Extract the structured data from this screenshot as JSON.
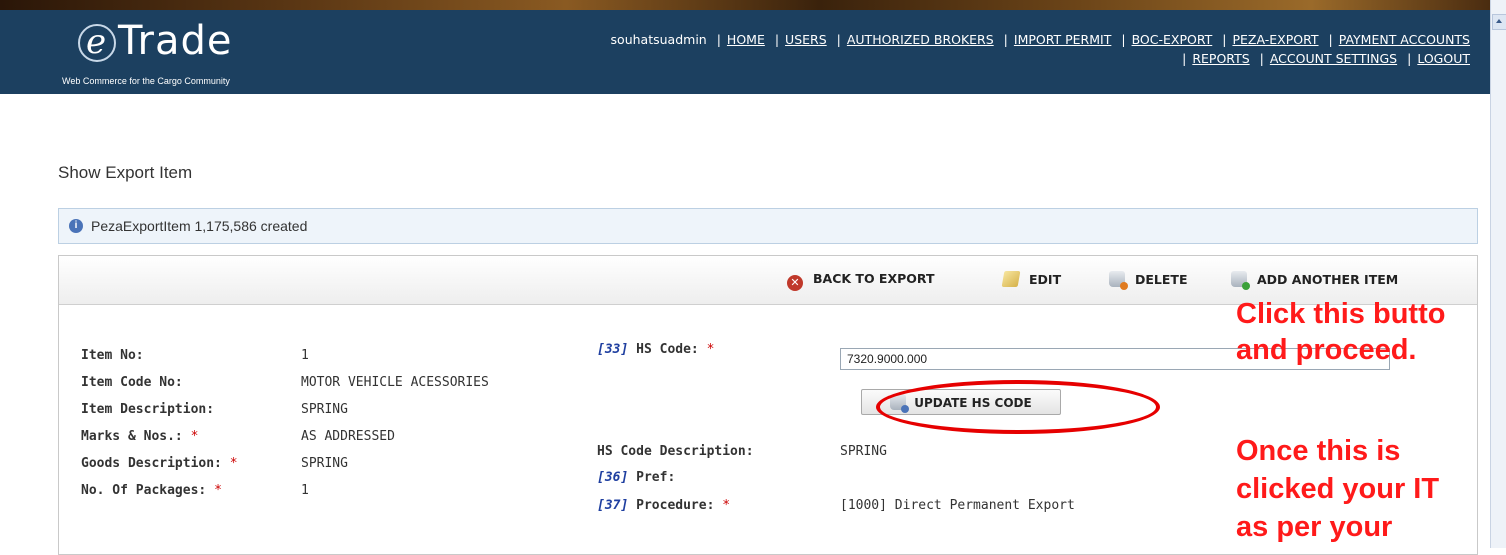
{
  "header": {
    "logo_letter": "e",
    "logo_word": "Trade",
    "tagline": "Web Commerce  for the Cargo Community",
    "username": "souhatsuadmin",
    "nav_row1": [
      "HOME",
      "USERS",
      "AUTHORIZED BROKERS",
      "IMPORT PERMIT",
      "BOC-EXPORT",
      "PEZA-EXPORT",
      "PAYMENT ACCOUNTS"
    ],
    "nav_row2": [
      "REPORTS",
      "ACCOUNT SETTINGS",
      "LOGOUT"
    ]
  },
  "page": {
    "title": "Show Export Item",
    "message": "PezaExportItem 1,175,586 created"
  },
  "toolbar": {
    "back_label": "BACK TO EXPORT",
    "edit_label": "EDIT",
    "delete_label": "DELETE",
    "add_label": "ADD ANOTHER ITEM"
  },
  "left_fields": [
    {
      "label": "Item No:",
      "required": false,
      "value": "1"
    },
    {
      "label": "Item Code No:",
      "required": false,
      "value": "MOTOR VEHICLE ACESSORIES"
    },
    {
      "label": "Item Description:",
      "required": false,
      "value": "SPRING"
    },
    {
      "label": "Marks & Nos.:",
      "required": true,
      "value": "AS ADDRESSED"
    },
    {
      "label": "Goods Description:",
      "required": true,
      "value": "SPRING"
    },
    {
      "label": "No. Of Packages:",
      "required": true,
      "value": "1"
    }
  ],
  "right_fields": {
    "hs_code_ref": "[33]",
    "hs_code_label": "HS Code:",
    "hs_code_value": "7320.9000.000",
    "update_button": "UPDATE HS CODE",
    "hs_desc_label": "HS Code Description:",
    "hs_desc_value": "SPRING",
    "pref_ref": "[36]",
    "pref_label": "Pref:",
    "procedure_ref": "[37]",
    "procedure_label": "Procedure:",
    "procedure_value": "[1000] Direct Permanent Export"
  },
  "annotation": {
    "line1": "Click this butto",
    "line2": "and proceed.",
    "line3": "Once this is",
    "line4": "clicked your IT",
    "line5": "as per your"
  },
  "colors": {
    "header_bg": "#1c4060",
    "annotation_red": "#ff1a1a",
    "required_star": "#cc0000",
    "ref_blue": "#1f3fa0"
  },
  "required_mark": "*"
}
